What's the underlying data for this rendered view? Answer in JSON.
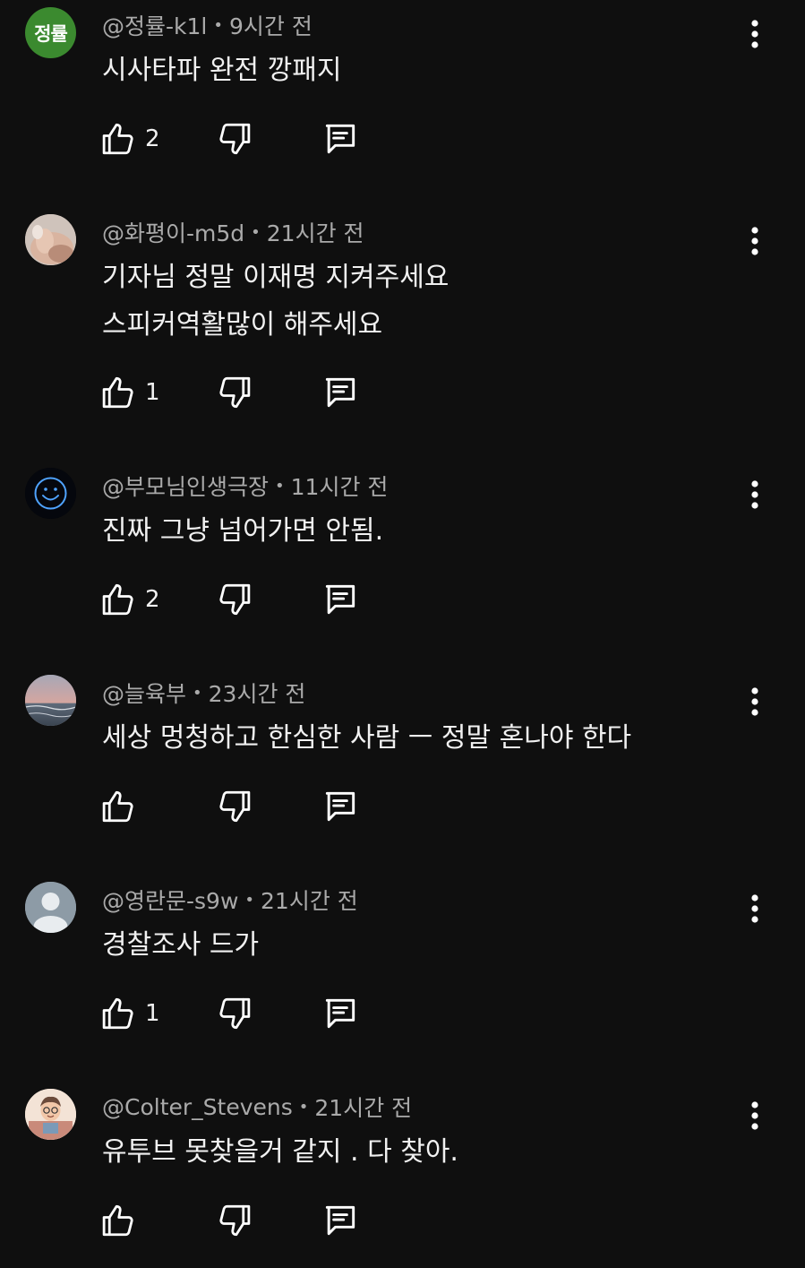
{
  "colors": {
    "background": "#0f0f0f",
    "text_primary": "#f1f1f1",
    "text_secondary": "#aaaaaa",
    "icon": "#ffffff"
  },
  "comments": [
    {
      "author": "@정률-k1l",
      "time": "9시간 전",
      "lines": [
        "시사타파 완전 깡패지"
      ],
      "likes": "2",
      "avatar": {
        "type": "text",
        "text": "정률",
        "color": "#3b8a2f"
      }
    },
    {
      "author": "@화평이-m5d",
      "time": "21시간 전",
      "lines": [
        "기자님 정말 이재명 지켜주세요",
        "스피커역활많이 해주세요"
      ],
      "likes": "1",
      "avatar": {
        "type": "photo-hand-icon"
      }
    },
    {
      "author": "@부모님인생극장",
      "time": "11시간 전",
      "lines": [
        "진짜 그냥 넘어가면 안됨."
      ],
      "likes": "2",
      "avatar": {
        "type": "smiley-icon"
      }
    },
    {
      "author": "@늘육부",
      "time": "23시간 전",
      "lines": [
        "세상 멍청하고 한심한 사람  ㅡ  정말 혼나야 한다"
      ],
      "likes": "",
      "avatar": {
        "type": "sea-sunset-icon"
      }
    },
    {
      "author": "@영란문-s9w",
      "time": "21시간 전",
      "lines": [
        "경찰조사 드가"
      ],
      "likes": "1",
      "avatar": {
        "type": "default-user-icon"
      }
    },
    {
      "author": "@Colter_Stevens",
      "time": "21시간 전",
      "lines": [
        "유투브 못찾을거 같지 . 다 찾아."
      ],
      "likes": "",
      "avatar": {
        "type": "cartoon-person-icon"
      }
    }
  ]
}
